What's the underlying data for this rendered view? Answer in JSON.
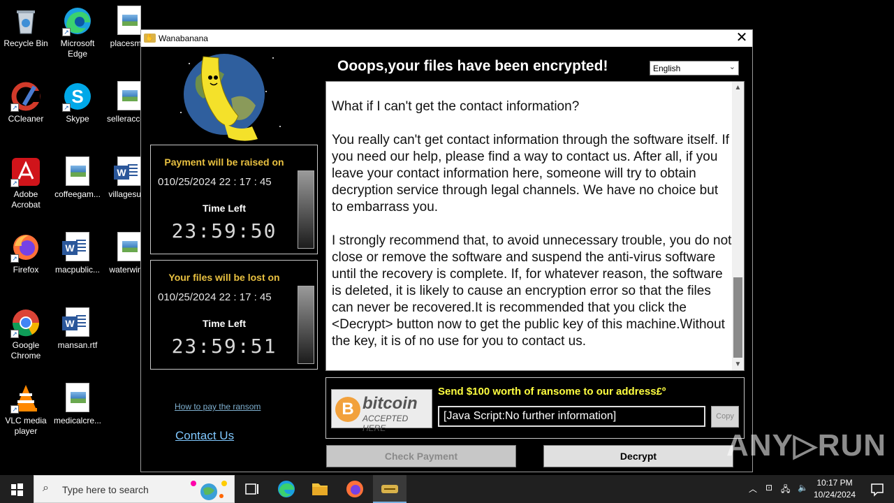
{
  "desktop": {
    "icons": [
      {
        "label": "Recycle Bin",
        "icon": "recycle-bin-icon"
      },
      {
        "label": "Microsoft Edge",
        "icon": "edge-icon"
      },
      {
        "label": "placesm...",
        "icon": "image-file-icon"
      },
      {
        "label": "CCleaner",
        "icon": "ccleaner-icon"
      },
      {
        "label": "Skype",
        "icon": "skype-icon"
      },
      {
        "label": "selleracce...",
        "icon": "image-file-icon"
      },
      {
        "label": "Adobe Acrobat",
        "icon": "acrobat-icon"
      },
      {
        "label": "coffeegam...",
        "icon": "image-file-icon"
      },
      {
        "label": "villagesul...",
        "icon": "word-file-icon"
      },
      {
        "label": "Firefox",
        "icon": "firefox-icon"
      },
      {
        "label": "macpublic...",
        "icon": "word-file-icon"
      },
      {
        "label": "waterwin...",
        "icon": "image-file-icon"
      },
      {
        "label": "Google Chrome",
        "icon": "chrome-icon"
      },
      {
        "label": "mansan.rtf",
        "icon": "word-file-icon"
      },
      {
        "label": "VLC media player",
        "icon": "vlc-icon"
      },
      {
        "label": "medicalcre...",
        "icon": "image-file-icon"
      }
    ]
  },
  "window": {
    "title": "Wanabanana",
    "close_glyph": "✕",
    "headline": "Ooops,your files have been encrypted!",
    "language": "English",
    "timer1": {
      "heading": "Payment will be raised on",
      "date": "010/25/2024 22 : 17 : 45",
      "time_left_label": "Time  Left",
      "countdown": "23:59:50"
    },
    "timer2": {
      "heading": "Your files will be lost on",
      "date": "010/25/2024 22 : 17 : 45",
      "time_left_label": "Time  Left",
      "countdown": "23:59:51"
    },
    "message": "What if I can't get the contact information?\n\nYou really can't get contact information through the software itself. If you need our help, please find a way to contact us. After all, if you leave your contact information here, someone will try to obtain decryption service through legal channels. We have no choice but to embarrass you.\n\nI strongly recommend that, to avoid unnecessary trouble, you do not close or remove the software and suspend the anti-virus software until the recovery is complete. If, for whatever reason, the software is deleted, it is likely to cause an encryption error so that the files can never be recovered.It is recommended that you click the <Decrypt> button now to get the public key of this machine.Without the key, it is of no use for you to contact us.",
    "bitcoin_logo": {
      "word": "bitcoin",
      "accepted": "ACCEPTED HERE",
      "symbol": "B"
    },
    "send_label": "Send $100 worth of ransome to our address£º",
    "address": "[Java Script:No further information]",
    "copy_label": "Copy",
    "how_to_pay": "How to pay the ransom",
    "contact_us": "Contact Us",
    "check_payment": "Check Payment",
    "decrypt": "Decrypt"
  },
  "watermark": "ANY▷RUN",
  "taskbar": {
    "search_placeholder": "Type here to search",
    "time": "10:17 PM",
    "date": "10/24/2024"
  }
}
